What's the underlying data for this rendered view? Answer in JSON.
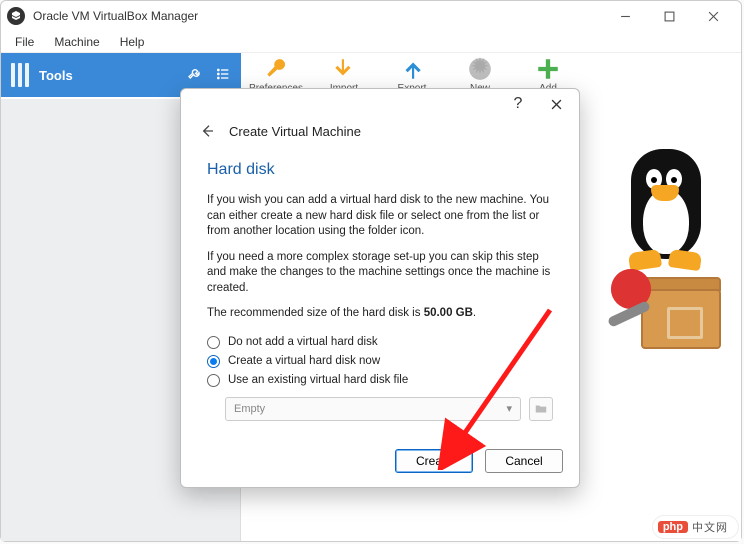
{
  "window": {
    "title": "Oracle VM VirtualBox Manager",
    "menus": [
      "File",
      "Machine",
      "Help"
    ],
    "tools_label": "Tools",
    "toolbar": [
      {
        "label": "Preferences",
        "icon": "wrench"
      },
      {
        "label": "Import",
        "icon": "import"
      },
      {
        "label": "Export",
        "icon": "export"
      },
      {
        "label": "New",
        "icon": "starburst"
      },
      {
        "label": "Add",
        "icon": "plus"
      }
    ]
  },
  "dialog": {
    "title": "Create Virtual Machine",
    "section_heading": "Hard disk",
    "paragraph1": "If you wish you can add a virtual hard disk to the new machine. You can either create a new hard disk file or select one from the list or from another location using the folder icon.",
    "paragraph2": "If you need a more complex storage set-up you can skip this step and make the changes to the machine settings once the machine is created.",
    "recommend_prefix": "The recommended size of the hard disk is ",
    "recommend_value": "50.00 GB",
    "recommend_suffix": ".",
    "options": [
      {
        "label": "Do not add a virtual hard disk",
        "selected": false
      },
      {
        "label": "Create a virtual hard disk now",
        "selected": true
      },
      {
        "label": "Use an existing virtual hard disk file",
        "selected": false
      }
    ],
    "file_selector_value": "Empty",
    "buttons": {
      "primary": "Create",
      "cancel": "Cancel"
    }
  },
  "watermark": {
    "brand": "php",
    "text": "中文网"
  }
}
